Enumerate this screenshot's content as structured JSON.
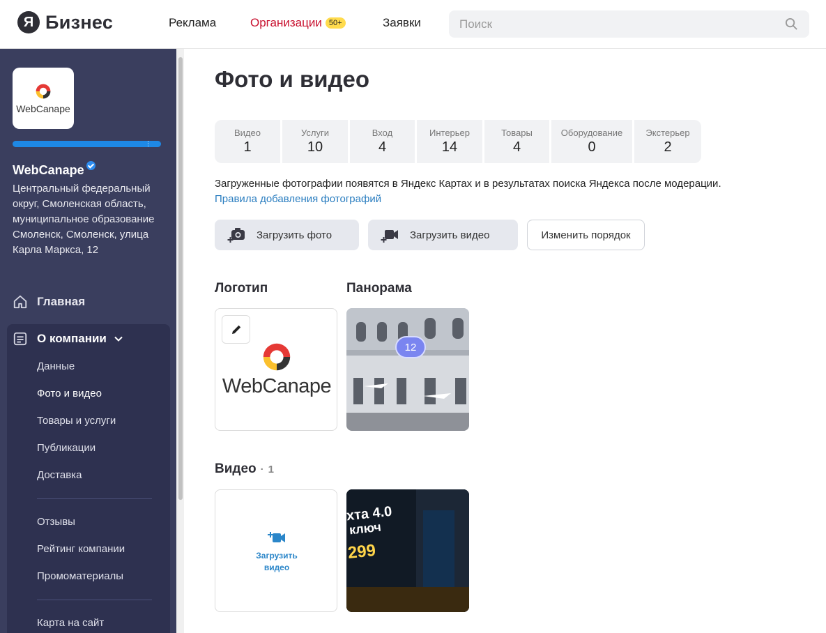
{
  "header": {
    "logo_letter": "Я",
    "logo_text": "Бизнес",
    "nav": [
      {
        "label": "Реклама"
      },
      {
        "label": "Организации",
        "badge": "50+"
      },
      {
        "label": "Заявки"
      }
    ],
    "search_placeholder": "Поиск",
    "accent_color": "#c8102e"
  },
  "sidebar": {
    "company_logo_text": "WebCanape",
    "company_name": "WebCanape",
    "address": "Центральный федеральный округ, Смоленская область, муниципальное образование Смоленск, Смоленск, улица Карла Маркса, 12",
    "main_item": "Главная",
    "about_item": "О компании",
    "sub_items": [
      "Данные",
      "Фото и видео",
      "Товары и услуги",
      "Публикации",
      "Доставка"
    ],
    "sub_items_2": [
      "Отзывы",
      "Рейтинг компании",
      "Промоматериалы"
    ],
    "sub_items_3": [
      "Карта на сайт"
    ]
  },
  "main": {
    "title": "Фото и видео",
    "stats": [
      {
        "label": "Видео",
        "value": "1"
      },
      {
        "label": "Услуги",
        "value": "10"
      },
      {
        "label": "Вход",
        "value": "4"
      },
      {
        "label": "Интерьер",
        "value": "14"
      },
      {
        "label": "Товары",
        "value": "4"
      },
      {
        "label": "Оборудование",
        "value": "0"
      },
      {
        "label": "Экстерьер",
        "value": "2"
      }
    ],
    "info_text": "Загруженные фотографии появятся в Яндекс Картах и в результатах поиска Яндекса после модерации.",
    "info_link": "Правила добавления фотографий",
    "buttons": {
      "upload_photo": "Загрузить фото",
      "upload_video": "Загрузить видео",
      "change_order": "Изменить порядок"
    },
    "logo_section": "Логотип",
    "panorama_section": "Панорама",
    "panorama_count": "12",
    "logo_card_text": "WebCanape",
    "video_section": "Видео",
    "video_count_sep": "·",
    "video_count": "1",
    "upload_video_card": "Загрузить видео",
    "video_thumb_text": [
      "хта 4.0",
      "ключ",
      "299"
    ]
  }
}
